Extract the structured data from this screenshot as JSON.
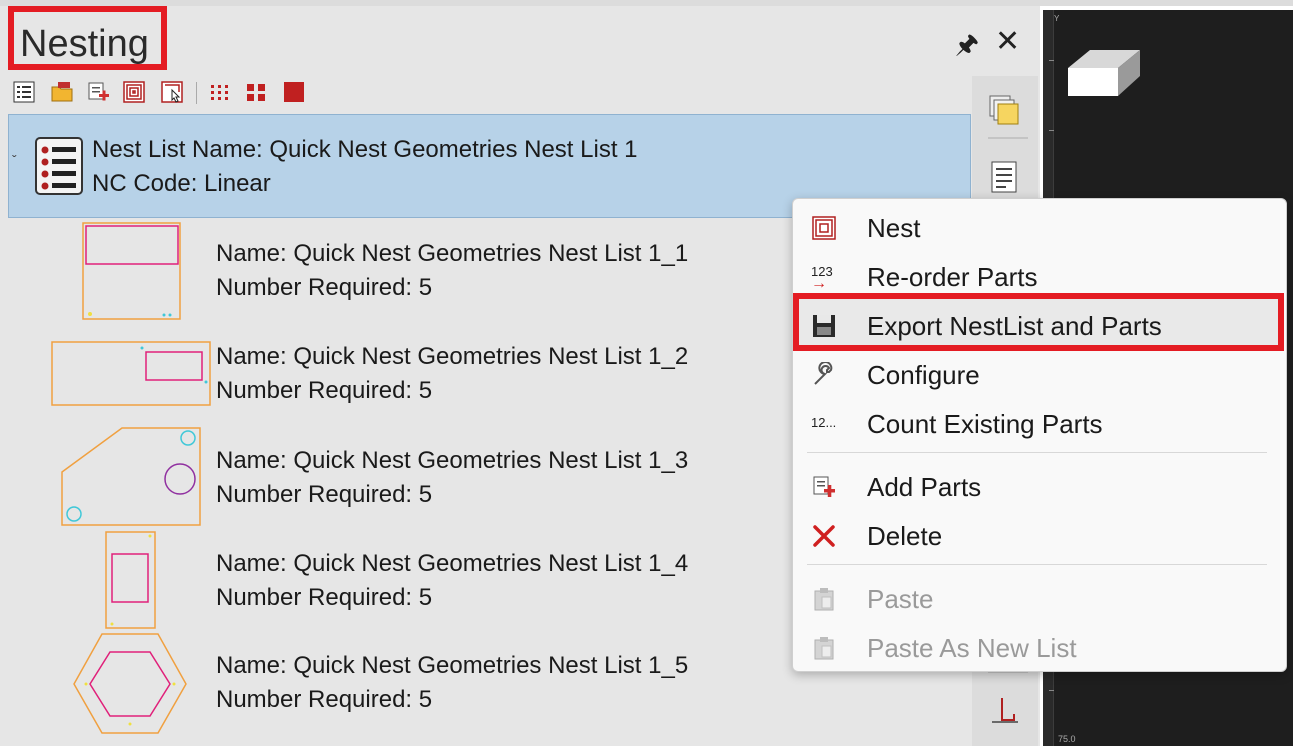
{
  "panel": {
    "title": "Nesting",
    "pin_icon": "pin-icon",
    "close_icon": "close-icon"
  },
  "toolbar": {
    "icons": [
      "list-icon",
      "open-folder-icon",
      "add-parts-icon",
      "nest-icon",
      "nest-pick-icon",
      "small-grid-icon",
      "medium-grid-icon",
      "solid-square-icon"
    ]
  },
  "nest_list": {
    "name": "Nest List Name: Quick Nest Geometries Nest List 1",
    "nc_code": "NC Code: Linear"
  },
  "parts": [
    {
      "name": "Name: Quick Nest Geometries Nest List 1_1",
      "required": "Number Required: 5"
    },
    {
      "name": "Name: Quick Nest Geometries Nest List 1_2",
      "required": "Number Required: 5"
    },
    {
      "name": "Name: Quick Nest Geometries Nest List 1_3",
      "required": "Number Required: 5"
    },
    {
      "name": "Name: Quick Nest Geometries Nest List 1_4",
      "required": "Number Required: 5"
    },
    {
      "name": "Name: Quick Nest Geometries Nest List 1_5",
      "required": "Number Required: 5"
    }
  ],
  "context_menu": {
    "items": [
      {
        "label": "Nest",
        "icon": "nest-icon",
        "enabled": true
      },
      {
        "label": "Re-order Parts",
        "icon": "reorder-123-icon",
        "enabled": true
      },
      {
        "label": "Export NestList and Parts",
        "icon": "save-disk-icon",
        "enabled": true,
        "highlighted": true
      },
      {
        "label": "Configure",
        "icon": "wrench-icon",
        "enabled": true
      },
      {
        "label": "Count Existing Parts",
        "icon": "count-12-icon",
        "enabled": true
      },
      {
        "label": "Add Parts",
        "icon": "add-parts-icon",
        "enabled": true
      },
      {
        "label": "Delete",
        "icon": "delete-x-icon",
        "enabled": true
      },
      {
        "label": "Paste",
        "icon": "clipboard-icon",
        "enabled": false
      },
      {
        "label": "Paste As New List",
        "icon": "clipboard-icon",
        "enabled": false
      }
    ],
    "reorder_icon_text": "123",
    "count_icon_text": "12..."
  },
  "canvas": {
    "axis_label_y": "Y",
    "axis_value": "75.0"
  },
  "colors": {
    "highlight_red": "#e41c23",
    "selection_blue": "#b7d2e8",
    "part_outline": "#f0a040",
    "part_inner": "#e0207a",
    "hole_cyan": "#40c8d8",
    "circle_purple": "#9030a0"
  }
}
